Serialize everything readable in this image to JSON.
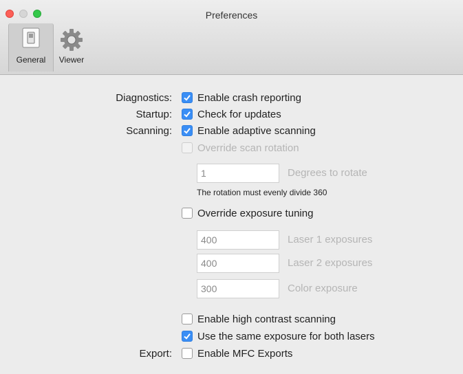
{
  "window": {
    "title": "Preferences"
  },
  "toolbar": {
    "tabs": [
      {
        "label": "General",
        "icon": "switch-icon",
        "selected": true
      },
      {
        "label": "Viewer",
        "icon": "gear-icon",
        "selected": false
      }
    ]
  },
  "settings": {
    "diagnostics": {
      "label": "Diagnostics:",
      "option": "Enable crash reporting",
      "checked": true
    },
    "startup": {
      "label": "Startup:",
      "option": "Check for updates",
      "checked": true
    },
    "scanning": {
      "label": "Scanning:",
      "adaptive": {
        "option": "Enable adaptive scanning",
        "checked": true
      },
      "rotation": {
        "option": "Override scan rotation",
        "checked": false,
        "enabled": false,
        "value": "1",
        "field_label": "Degrees to rotate",
        "hint": "The rotation must evenly divide 360"
      },
      "exposure": {
        "option": "Override exposure tuning",
        "checked": false,
        "laser1": {
          "value": "400",
          "label": "Laser 1 exposures"
        },
        "laser2": {
          "value": "400",
          "label": "Laser 2 exposures"
        },
        "color": {
          "value": "300",
          "label": "Color exposure"
        }
      },
      "high_contrast": {
        "option": "Enable high contrast scanning",
        "checked": false
      },
      "same_exposure": {
        "option": "Use the same exposure for both lasers",
        "checked": true
      }
    },
    "export": {
      "label": "Export:",
      "option": "Enable MFC Exports",
      "checked": false
    }
  },
  "colors": {
    "accent": "#3a8ef5",
    "close": "#fc5f57",
    "zoom": "#34c84a"
  }
}
